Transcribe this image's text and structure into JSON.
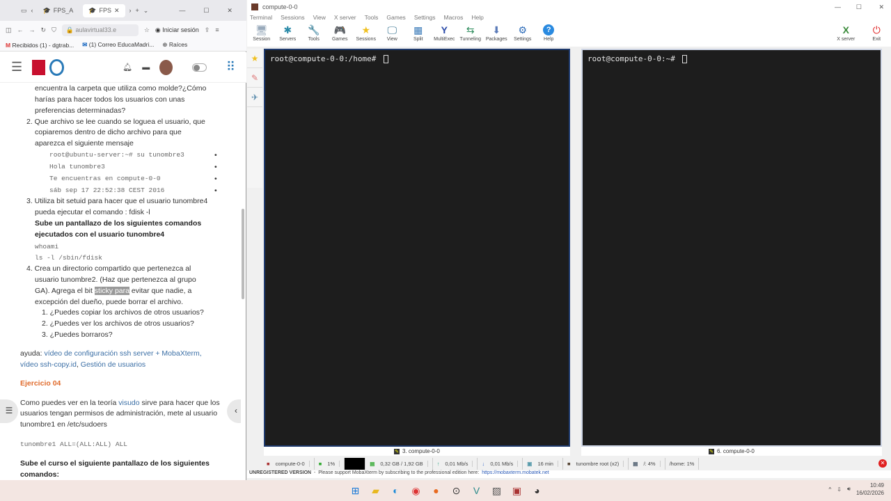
{
  "browser": {
    "tabs": [
      {
        "label": "FPS_A"
      },
      {
        "label": "FPS"
      }
    ],
    "url": "aulavirtual33.e",
    "signin": "Iniciar sesión",
    "bookmarks": [
      "Recibidos (1) - dgtrab...",
      "(1) Correo EducaMadri...",
      "Raíces"
    ],
    "content": {
      "l1": "encuentra la carpeta que utiliza como molde?¿Cómo",
      "l2": "harías para hacer todos los usuarios con unas",
      "l3": "preferencias determinadas?",
      "q2a": "2. Que archivo se lee cuando se loguea el usuario, que",
      "q2b": "copiaremos dentro de dicho archivo para que",
      "q2c": "aparezca el siguiente mensaje",
      "code": [
        "root@ubuntu-server:~# su tunombre3",
        "Hola tunombre3",
        "Te encuentras en compute-0-0",
        "sáb sep 17 22:52:38 CEST 2016"
      ],
      "q3a": "3. Utiliza bit setuid para hacer que el usuario tunombre4",
      "q3b": "pueda ejecutar el comando : fdisk  -l",
      "q3c": "Sube un pantallazo de los siguientes comandos",
      "q3d": "ejecutados con el usuario tunombre4",
      "cmd1": "whoami",
      "cmd2": "ls -l /sbin/fdisk",
      "q4a": "4. Crea un directorio compartido que pertenezca al",
      "q4b": "usuario tunombre2. (Haz que pertenezca al grupo",
      "q4c1": "GA). Agrega el bit ",
      "q4c2": "sticky para",
      "q4c3": " evitar que nadie, a",
      "q4d": "excepción del dueño, puede borrar el archivo.",
      "sub": [
        "1. ¿Puedes copiar los archivos de otros usuarios?",
        "2. ¿Puedes ver los archivos de otros usuarios?",
        "3. ¿Puedes borraros?"
      ],
      "ayuda": "ayuda: ",
      "link1": "vídeo de configuración ssh server + MobaXterm,",
      "link2": "vídeo ssh-copy.id",
      "link3": "Gestión de usuarios",
      "ej": "Ejercicio  04",
      "e1a": "Como puedes ver en la teoría ",
      "e1link": "visudo",
      "e1b": " sirve para hacer que los",
      "e2": "usuarios tengan permisos de administración, mete al usuario",
      "e3": "tunombre1 en /etc/sudoers",
      "sudo": "tunombre1 ALL=(ALL:ALL) ALL",
      "final1": "Sube el curso el siguiente pantallazo de los siguientes",
      "final2": "comandos:"
    }
  },
  "moba": {
    "title": "compute-0-0",
    "menu": [
      "Terminal",
      "Sessions",
      "View",
      "X server",
      "Tools",
      "Games",
      "Settings",
      "Macros",
      "Help"
    ],
    "tools": [
      {
        "label": "Session",
        "icon": "🖥"
      },
      {
        "label": "Servers",
        "icon": "✱"
      },
      {
        "label": "Tools",
        "icon": "🔧"
      },
      {
        "label": "Games",
        "icon": "🎮"
      },
      {
        "label": "Sessions",
        "icon": "★"
      },
      {
        "label": "View",
        "icon": "🖵"
      },
      {
        "label": "Split",
        "icon": "▦"
      },
      {
        "label": "MultiExec",
        "icon": "Y"
      },
      {
        "label": "Tunneling",
        "icon": "⇆"
      },
      {
        "label": "Packages",
        "icon": "⬇"
      },
      {
        "label": "Settings",
        "icon": "⚙"
      },
      {
        "label": "Help",
        "icon": "?"
      }
    ],
    "xserver": "X server",
    "exit": "Exit",
    "term1": {
      "prompt": "root@compute-0-0:/home# ",
      "label": "3. compute-0-0"
    },
    "term2": {
      "prompt": "root@compute-0-0:~# ",
      "label": "6. compute-0-0"
    },
    "status": [
      "compute-0-0",
      "1%",
      "0,32 GB / 1,92 GB",
      "0,01 Mb/s",
      "0,01 Mb/s",
      "16 min",
      "tunombre  root (x2)",
      "/: 4%",
      "/home: 1%"
    ],
    "unreg": "UNREGISTERED VERSION",
    "unreg_msg": "  -  Please support MobaXterm by subscribing to the professional edition here:  ",
    "unreg_link": "https://mobaxterm.mobatek.net"
  },
  "taskbar": {
    "time": "10:49",
    "date": "16/02/2026"
  }
}
